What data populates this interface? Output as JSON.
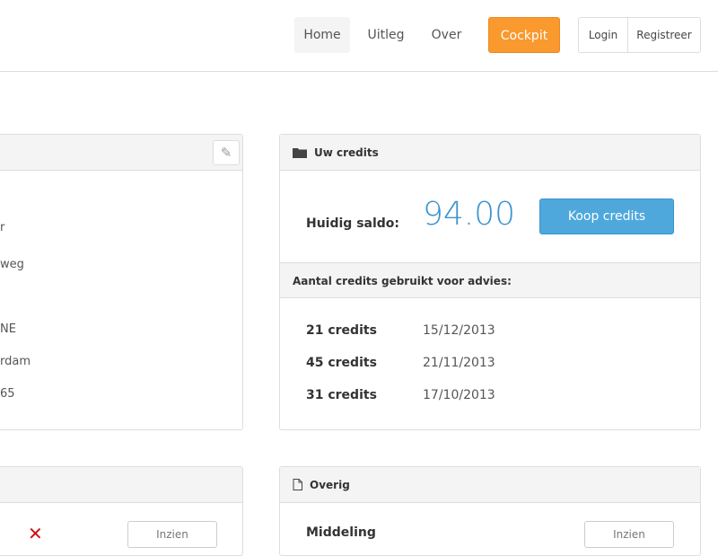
{
  "nav": {
    "items": [
      "Home",
      "Uitleg",
      "Over"
    ],
    "cockpit": "Cockpit",
    "login": "Login",
    "register": "Registreer"
  },
  "profile": {
    "fragments": [
      "r",
      "weg",
      "NE",
      "rdam",
      "65"
    ]
  },
  "credits": {
    "title": "Uw credits",
    "saldo_label": "Huidig saldo:",
    "saldo": "94.00",
    "buy": "Koop credits",
    "used_header": "Aantal credits gebruikt voor advies:",
    "rows": [
      {
        "amount": "21 credits",
        "date": "15/12/2013"
      },
      {
        "amount": "45 credits",
        "date": "21/11/2013"
      },
      {
        "amount": "31 credits",
        "date": "17/10/2013"
      }
    ]
  },
  "bottom_left": {
    "button": "Inzien",
    "status_icon": "cross-icon"
  },
  "overig": {
    "title": "Overig",
    "item": "Middeling",
    "button": "Inzien"
  },
  "colors": {
    "accent": "#4ea8dc",
    "cockpit": "#f9992e",
    "cross": "#cc1111"
  }
}
